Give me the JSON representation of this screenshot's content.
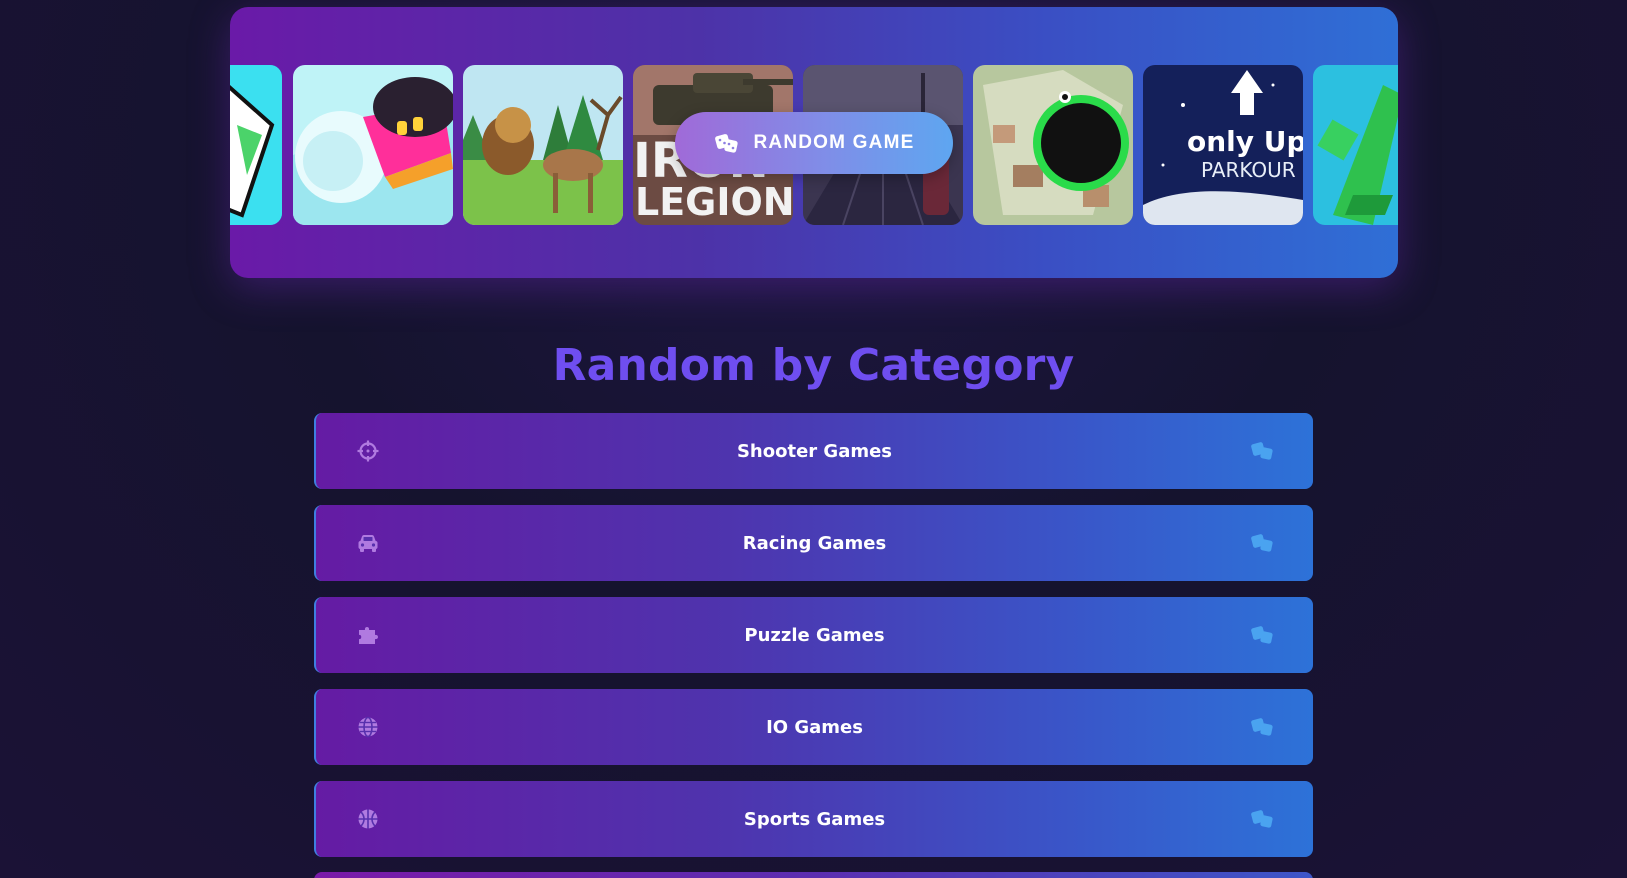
{
  "carousel": {
    "random_button_label": "RANDOM GAME",
    "random_button_icon": "dice-icon",
    "thumbnails": [
      {
        "name": "thumb-partial-left",
        "caption": ""
      },
      {
        "name": "thumb-snowball",
        "caption": ""
      },
      {
        "name": "thumb-lion-deer",
        "caption": ""
      },
      {
        "name": "thumb-iron-legion",
        "caption_line1": "IRON",
        "caption_line2": "LEGION"
      },
      {
        "name": "thumb-dark-street",
        "caption": ""
      },
      {
        "name": "thumb-black-hole",
        "caption": ""
      },
      {
        "name": "thumb-only-up",
        "caption_line1": "only Up",
        "caption_line2": "PARKOUR"
      },
      {
        "name": "thumb-partial-right",
        "caption": ""
      }
    ]
  },
  "section": {
    "title": "Random by Category"
  },
  "categories": [
    {
      "label": "Shooter Games",
      "icon": "crosshair-icon"
    },
    {
      "label": "Racing Games",
      "icon": "car-icon"
    },
    {
      "label": "Puzzle Games",
      "icon": "puzzle-piece-icon"
    },
    {
      "label": "IO Games",
      "icon": "globe-icon"
    },
    {
      "label": "Sports Games",
      "icon": "basketball-icon"
    }
  ],
  "colors": {
    "accent_title": "#6f4ef0",
    "dice_icon": "#4aa3f0",
    "category_icon": "#b07ae0"
  }
}
